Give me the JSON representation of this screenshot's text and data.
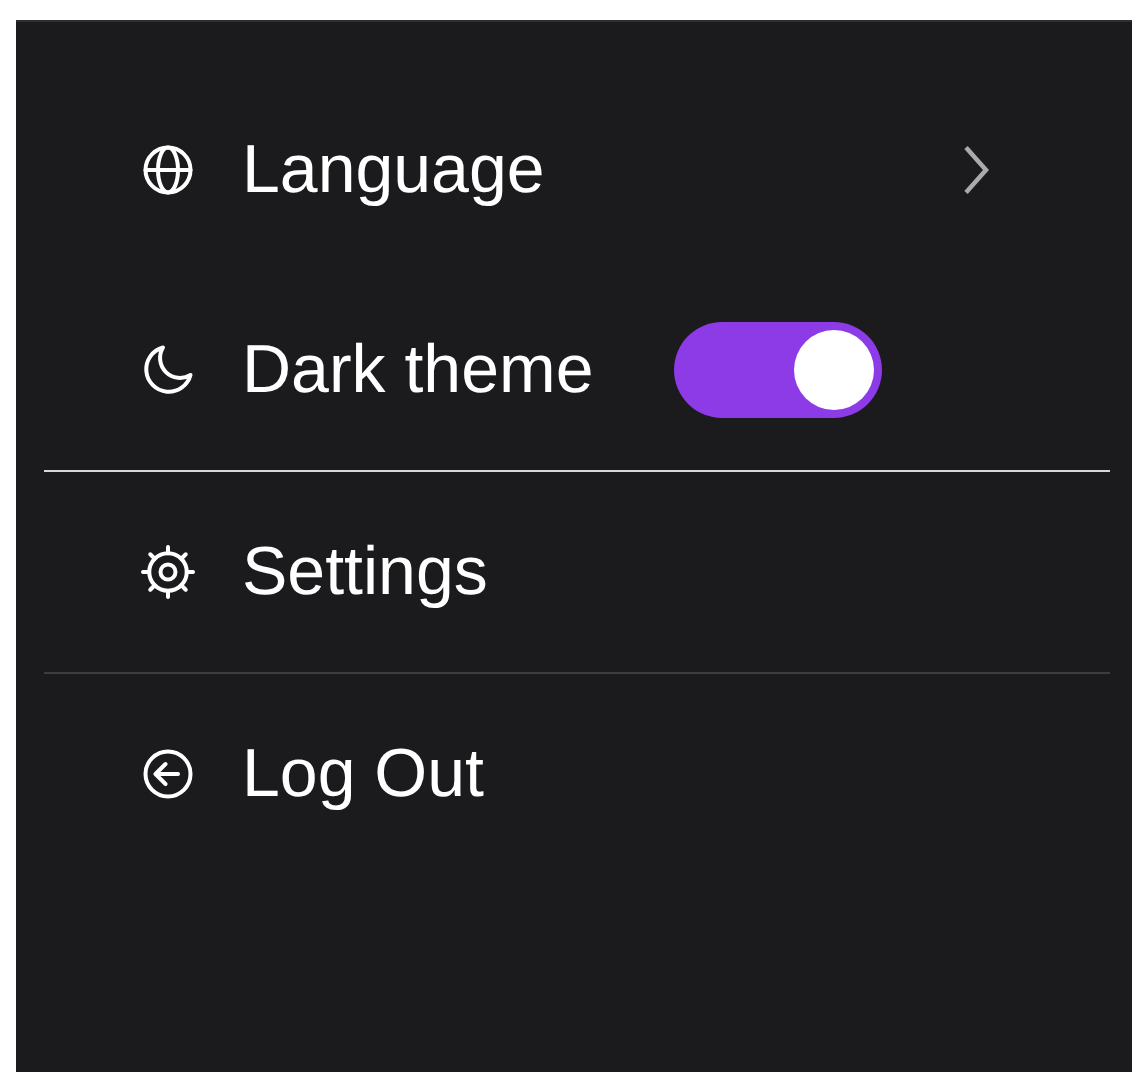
{
  "menu": [
    {
      "kind": "submenu",
      "label": "Language"
    },
    {
      "kind": "toggle",
      "label": "Dark theme",
      "on": true
    },
    {
      "kind": "divider",
      "strong": true
    },
    {
      "kind": "item",
      "label": "Settings"
    },
    {
      "kind": "divider",
      "strong": false
    },
    {
      "kind": "item",
      "label": "Log Out"
    }
  ]
}
